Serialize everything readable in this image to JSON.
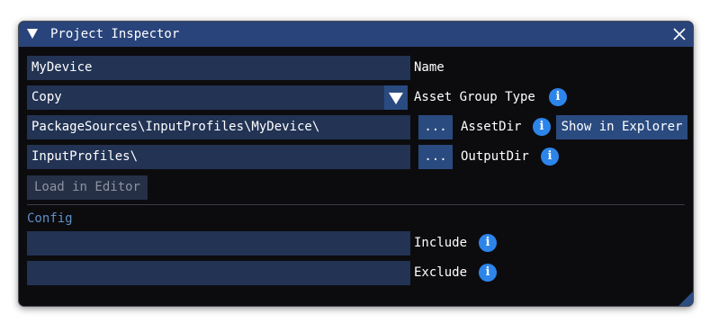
{
  "window": {
    "title": "Project Inspector"
  },
  "fields": {
    "name_value": "MyDevice",
    "name_label": "Name",
    "asset_group_type_value": "Copy",
    "asset_group_type_label": "Asset Group Type",
    "asset_dir_value": "PackageSources\\InputProfiles\\MyDevice\\",
    "asset_dir_browse": "...",
    "asset_dir_label": "AssetDir",
    "show_in_explorer": "Show in Explorer",
    "output_dir_value": "InputProfiles\\",
    "output_dir_browse": "...",
    "output_dir_label": "OutputDir",
    "load_in_editor": "Load in Editor"
  },
  "config": {
    "header": "Config",
    "include_value": "",
    "include_label": "Include",
    "exclude_value": "",
    "exclude_label": "Exclude"
  },
  "icons": {
    "info_glyph": "i",
    "collapse": "triangle-down-icon",
    "close": "close-icon",
    "info": "info-icon",
    "dropdown": "dropdown-arrow-icon",
    "resize": "resize-grip-icon"
  },
  "colors": {
    "window_bg": "#0c0c0f",
    "titlebar_bg": "#29447a",
    "field_bg": "#223354",
    "button_bg": "#2a4b80",
    "info_icon_bg": "#2d85ea",
    "section_header": "#5f90c9",
    "disabled_text": "#8d93a1"
  }
}
